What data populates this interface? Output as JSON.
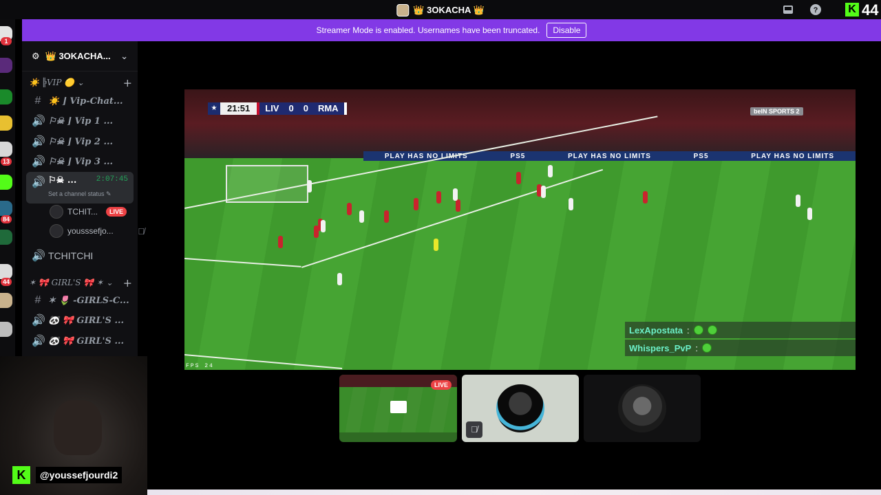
{
  "titlebar": {
    "server_name": "👑 3OKACHA 👑",
    "viewer_count": "44",
    "kick_logo": "K",
    "icons": [
      "inbox-icon",
      "help-icon"
    ]
  },
  "banner": {
    "message": "Streamer Mode is enabled. Usernames have been truncated.",
    "disable_label": "Disable"
  },
  "rail": {
    "badges": [
      "1",
      "13",
      "84",
      "44"
    ]
  },
  "sidebar": {
    "server_name": "👑 3OKACHA...",
    "categories": [
      {
        "label": "☀️ ╠VIP 🟡"
      },
      {
        "label": "✶ 🎀 GIRL'S 🎀 ✶"
      }
    ],
    "channels": [
      {
        "icon": "#",
        "label": "☀️ ⌋ Vip-Chat..."
      },
      {
        "icon": "🔊",
        "label": "⚐☠ ⌋ Vip 1 ..."
      },
      {
        "icon": "🔊",
        "label": "⚐☠ ⌋ Vip 2 ..."
      },
      {
        "icon": "🔊",
        "label": "⚐☠ ⌋ Vip 3 ..."
      },
      {
        "icon": "🔊",
        "label": "⚐☠ ...",
        "timer": "2:07:45",
        "status": "Set a channel status ✎"
      },
      {
        "icon": "🔊",
        "label": "TCHITCHI"
      },
      {
        "icon": "#",
        "label": "✶ 🌷 -GIRLS-C..."
      },
      {
        "icon": "🔊",
        "label": "🐼 🎀 GIRL'S ..."
      },
      {
        "icon": "🔊",
        "label": "🐼 🎀 GIRL'S ..."
      }
    ],
    "voice_users": [
      {
        "name": "TCHIT...",
        "badge": "LIVE"
      },
      {
        "name": "yousssefjo..."
      }
    ]
  },
  "stage": {
    "scorebug": {
      "clock": "21:51",
      "home": "LIV",
      "home_score": "0",
      "away_score": "0",
      "away": "RMA"
    },
    "broadcaster": "beIN SPORTS 2",
    "ad_text": [
      "PLAY HAS NO LIMITS",
      "PS5",
      "PLAY HAS NO LIMITS",
      "PS5",
      "PLAY HAS NO LIMITS"
    ],
    "fps_label": "FPS 24",
    "chat": [
      {
        "user": "LexApostata",
        "sep": ":"
      },
      {
        "user": "Whispers_PvP",
        "sep": ":"
      }
    ]
  },
  "tiles": [
    {
      "type": "stream",
      "badge": "LIVE"
    },
    {
      "type": "speaking"
    },
    {
      "type": "dark"
    }
  ],
  "webcam": {
    "handle": "@youssefjourdi2",
    "kick_logo": "K"
  },
  "colors": {
    "banner": "#8239e6",
    "kick_green": "#53fc18",
    "live_red": "#ed4245"
  }
}
